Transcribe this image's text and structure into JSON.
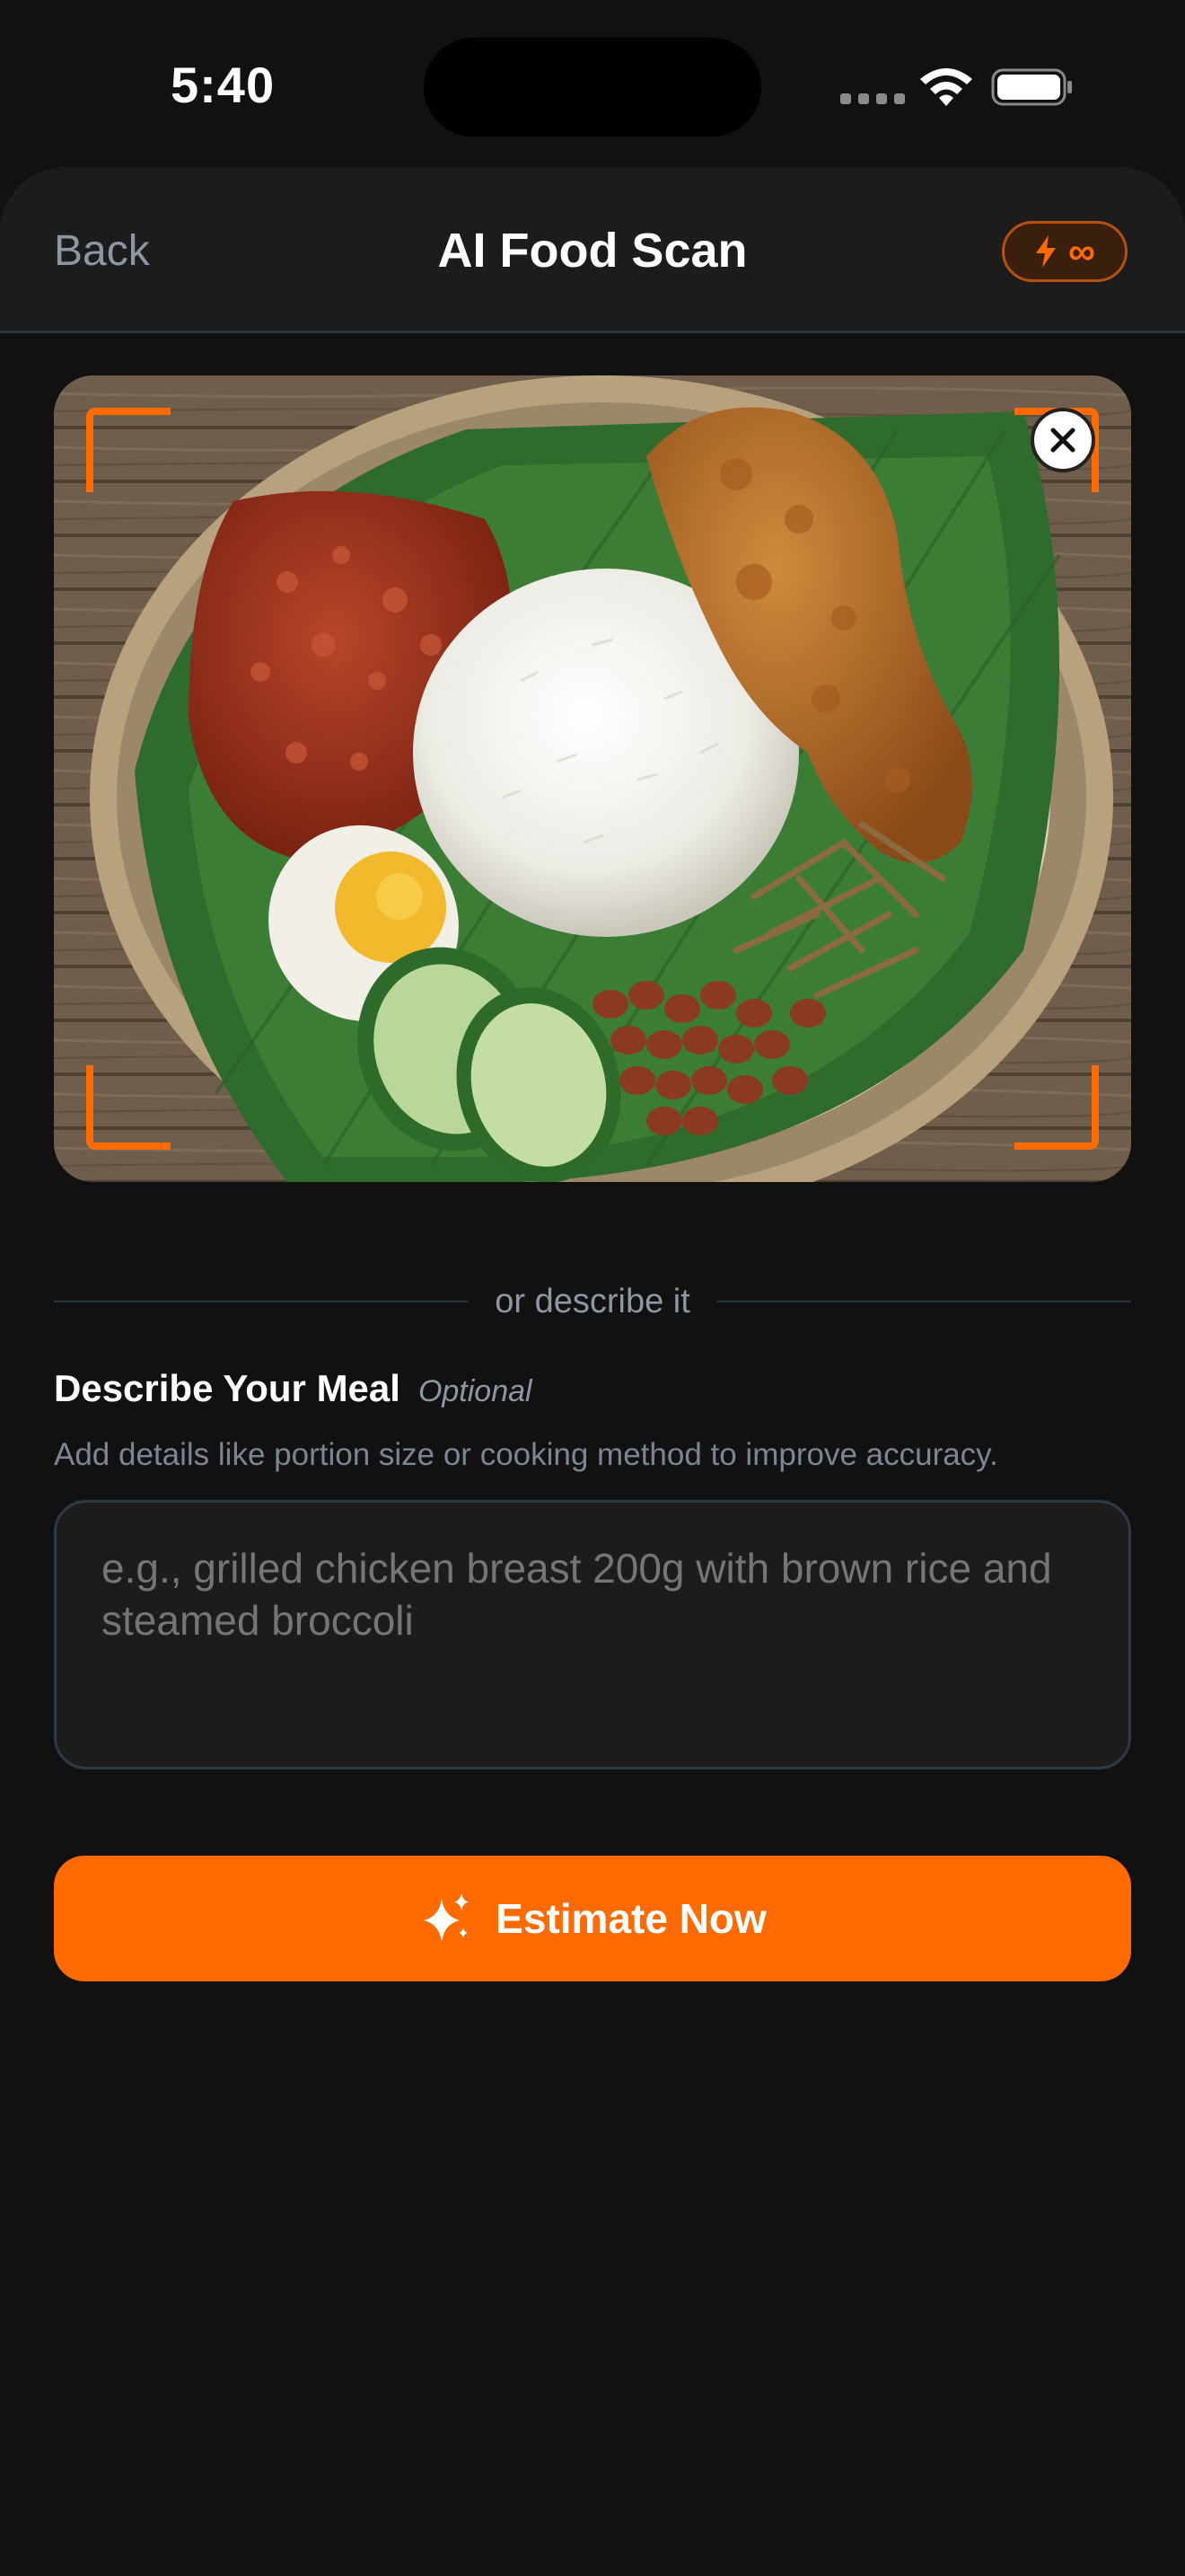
{
  "status_bar": {
    "time": "5:40"
  },
  "nav": {
    "back_label": "Back",
    "title": "AI Food Scan",
    "badge_symbol": "∞"
  },
  "photo": {
    "alt": "Nasi lemak with fried chicken"
  },
  "divider": {
    "text": "or describe it"
  },
  "describe": {
    "title": "Describe Your Meal",
    "optional_label": "Optional",
    "hint": "Add details like portion size or cooking method to improve accuracy.",
    "placeholder": "e.g., grilled chicken breast 200g with brown rice and steamed broccoli"
  },
  "cta": {
    "label": "Estimate Now"
  },
  "colors": {
    "accent": "#ff6b00",
    "background": "#111111",
    "surface": "#1c1c1c",
    "muted_text": "#8e96a3"
  },
  "icons": {
    "badge": "bolt-icon",
    "close": "close-icon",
    "cta": "sparkle-icon"
  }
}
